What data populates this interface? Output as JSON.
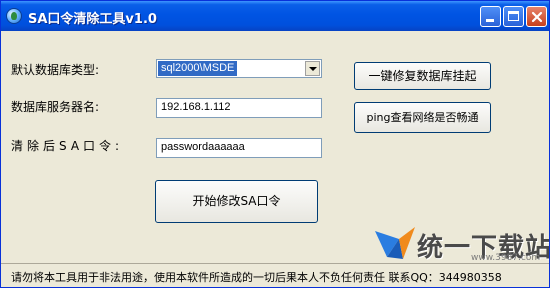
{
  "window": {
    "title": "SA口令清除工具v1.0"
  },
  "labels": {
    "db_type": "默认数据库类型:",
    "server_name": "数据库服务器名:",
    "sa_password": "清除后SA口令:"
  },
  "fields": {
    "db_type_selected": "sql2000\\MSDE",
    "server_name": "192.168.1.112",
    "sa_password": "passwordaaaaaa"
  },
  "buttons": {
    "repair_db": "一键修复数据库挂起",
    "ping_check": "ping查看网络是否畅通",
    "start_modify": "开始修改SA口令"
  },
  "status_bar": {
    "text": "请勿将本工具用于非法用途，使用本软件所造成的一切后果本人不负任何责任  联系QQ：344980358"
  },
  "watermark": {
    "brand": "统一下载站",
    "url": "www.3987.com"
  }
}
